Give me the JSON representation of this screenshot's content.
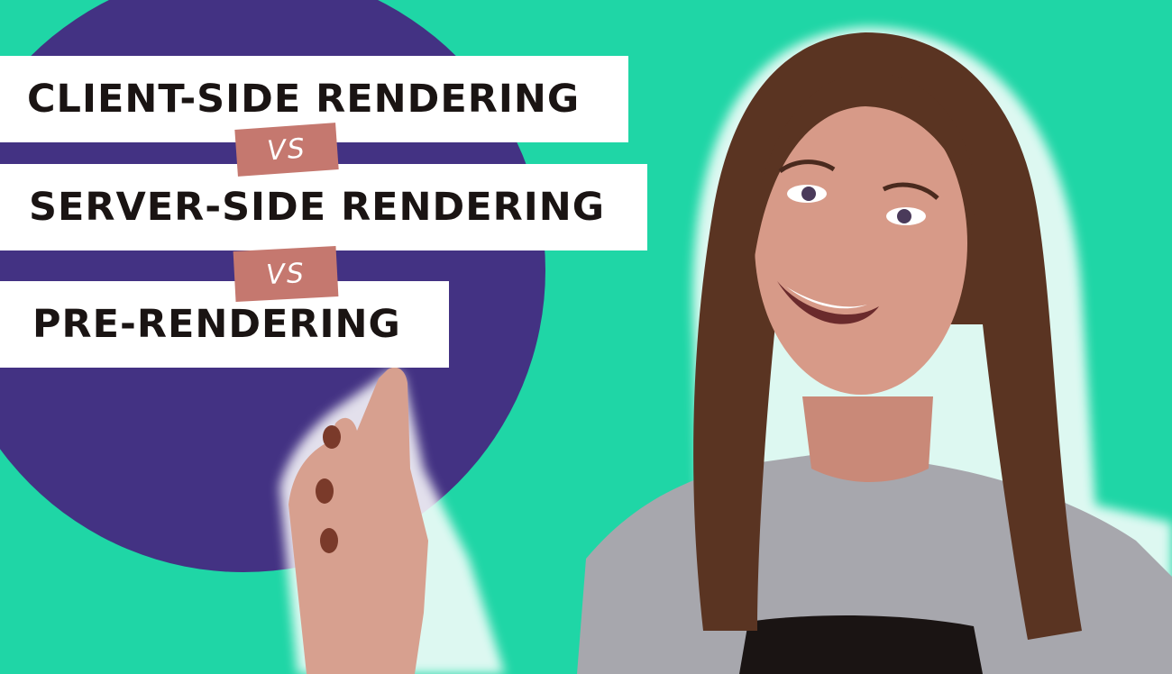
{
  "banners": [
    {
      "text": "CLIENT-SIDE RENDERING"
    },
    {
      "text": "SERVER-SIDE RENDERING"
    },
    {
      "text": "PRE-RENDERING"
    }
  ],
  "separators": [
    {
      "text": "VS"
    },
    {
      "text": "VS"
    }
  ],
  "colors": {
    "background": "#1fd6a6",
    "circle": "#433283",
    "banner": "#ffffff",
    "text": "#1a1413",
    "vs_badge": "#c5786f"
  }
}
